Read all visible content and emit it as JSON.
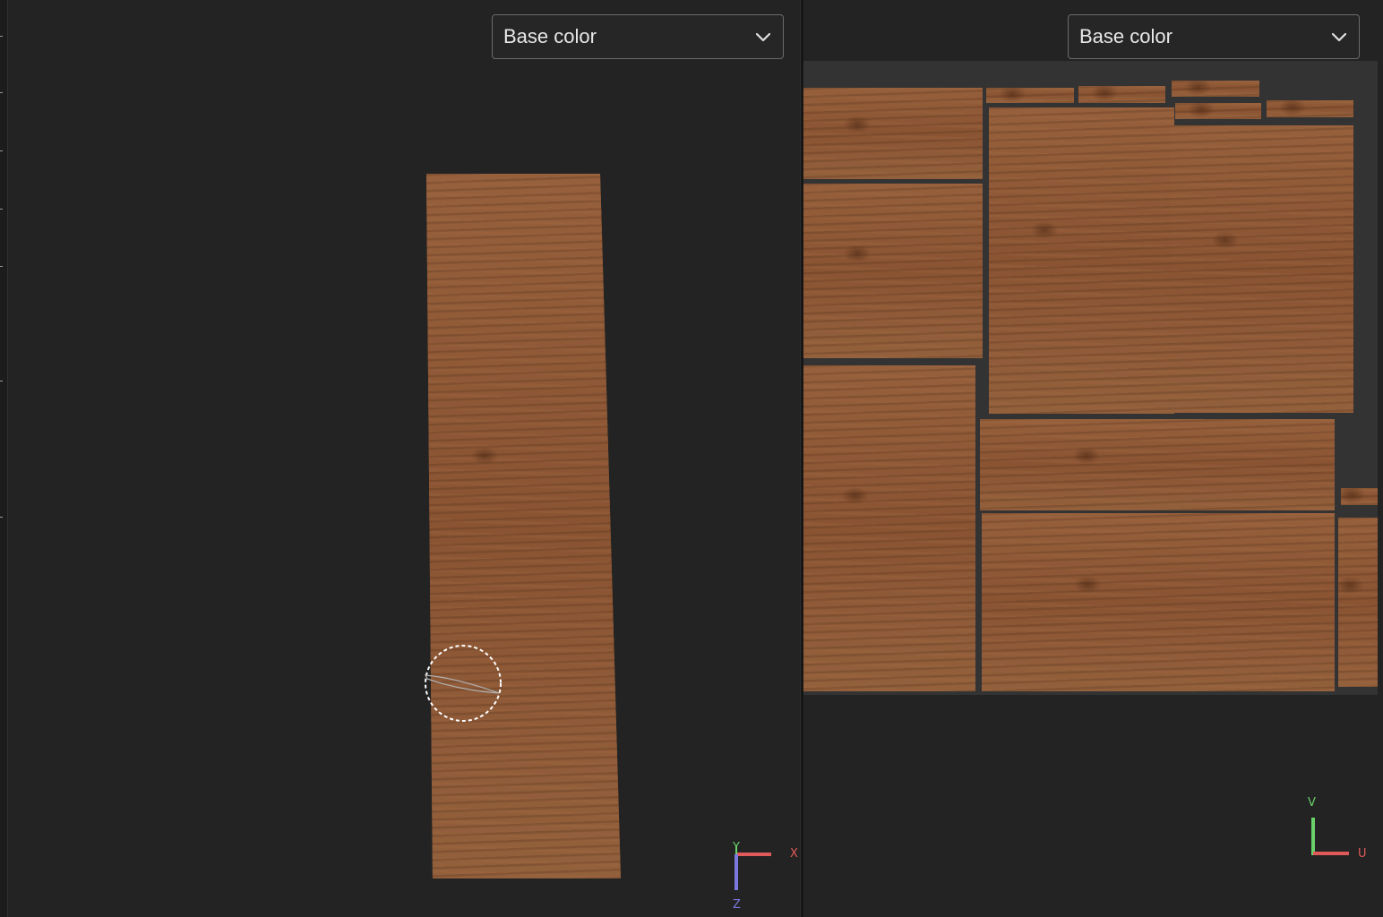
{
  "viewport_3d": {
    "channel_dropdown": {
      "selected": "Base color"
    },
    "gizmo": {
      "x_label": "X",
      "y_label": "Y",
      "z_label": "Z"
    },
    "colors": {
      "x_axis": "#e05a5a",
      "y_axis": "#6ad06a",
      "z_axis": "#7b78e0"
    }
  },
  "viewport_2d": {
    "channel_dropdown": {
      "selected": "Base color"
    },
    "gizmo": {
      "u_label": "U",
      "v_label": "V"
    },
    "colors": {
      "u_axis": "#e05a5a",
      "v_axis": "#6ad06a"
    }
  },
  "colors": {
    "background": "#232323",
    "wood": "#8b5735"
  },
  "icons": [
    "chevron-down-icon",
    "brush-cursor-icon",
    "axis-gizmo-icon"
  ]
}
